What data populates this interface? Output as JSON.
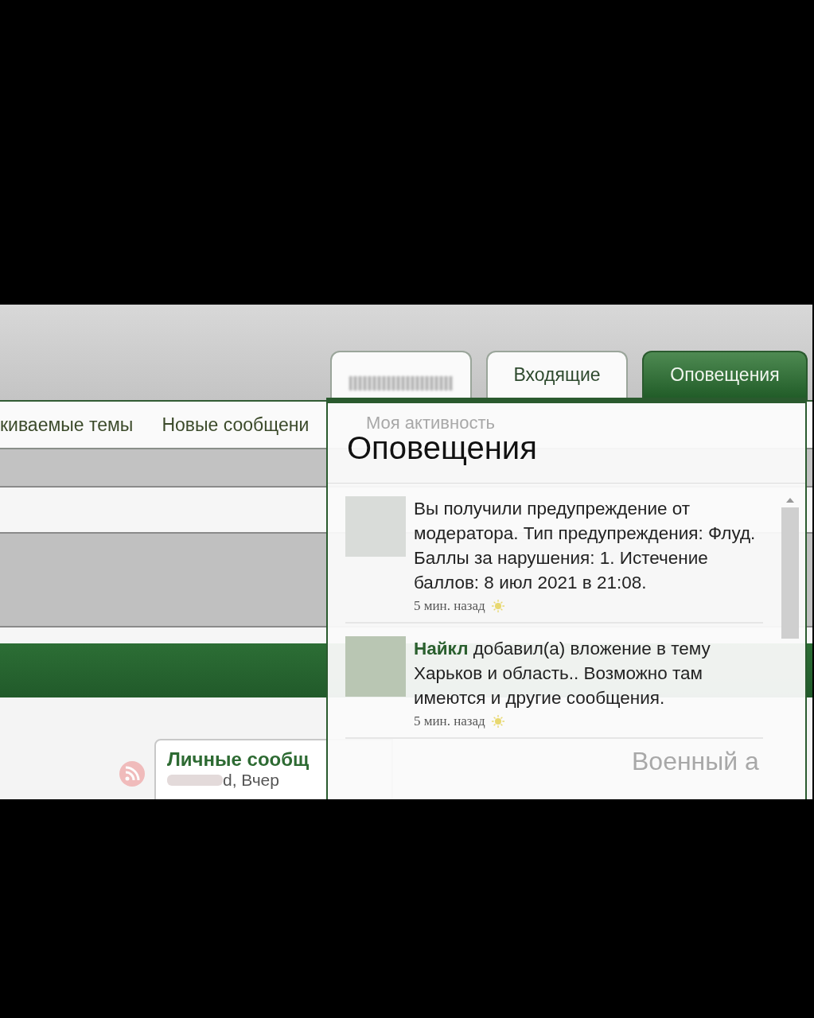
{
  "header_tabs": [
    {
      "kind": "blurred",
      "selected": false
    },
    {
      "kind": "text",
      "label": "Входящие",
      "selected": false
    },
    {
      "kind": "text",
      "label": "Оповещения",
      "selected": true
    }
  ],
  "nav_links": [
    "киваемые темы",
    "Новые сообщени"
  ],
  "card": {
    "title": "Личные сообщ",
    "meta": "d, Вчер"
  },
  "popup": {
    "title": "Оповещения",
    "behind_link": "Моя активность",
    "behind_text": "Военный а",
    "items": [
      {
        "text": "Вы получили предупреждение от модератора. Тип предупреждения: Флуд. Баллы за нарушения: 1. Истечение баллов: 8 июл 2021 в 21:08.",
        "time": "5 мин. назад"
      },
      {
        "text": "**Найкл** добавил(а) вложение в тему Харьков и область.. Возможно там имеются и другие сообщения.",
        "time": "5 мин. назад"
      }
    ]
  }
}
